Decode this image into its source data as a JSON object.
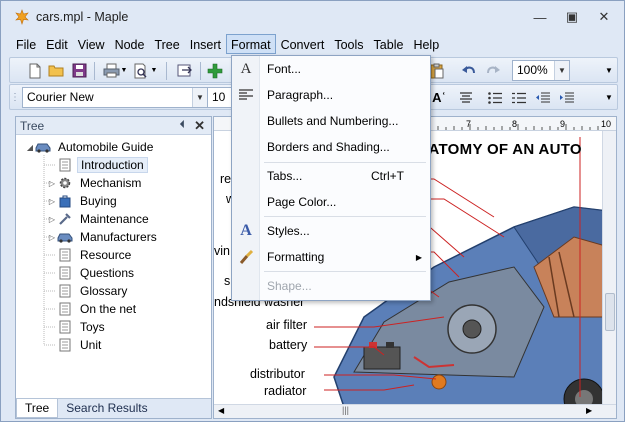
{
  "window": {
    "title": "cars.mpl - Maple",
    "controls": [
      "minimize-icon",
      "restore-icon",
      "close-icon"
    ]
  },
  "menubar": {
    "items": [
      "File",
      "Edit",
      "View",
      "Node",
      "Tree",
      "Insert",
      "Format",
      "Convert",
      "Tools",
      "Table",
      "Help"
    ],
    "active": "Format"
  },
  "toolbar": {
    "zoom": "100%",
    "font_name": "Courier New",
    "font_size": "10"
  },
  "tree_pane": {
    "title": "Tree",
    "root": "Automobile Guide",
    "nodes": [
      "Introduction",
      "Mechanism",
      "Buying",
      "Maintenance",
      "Manufacturers",
      "Resource",
      "Questions",
      "Glossary",
      "On the net",
      "Toys",
      "Unit"
    ],
    "selected": "Introduction",
    "tabs": [
      "Tree",
      "Search Results"
    ]
  },
  "format_menu": {
    "items": [
      {
        "label": "Font...",
        "icon": "font-icon"
      },
      {
        "label": "Paragraph...",
        "icon": "paragraph-icon"
      },
      {
        "label": "Bullets and Numbering...",
        "icon": ""
      },
      {
        "label": "Borders and Shading...",
        "icon": ""
      },
      {
        "label": "Tabs...",
        "shortcut": "Ctrl+T",
        "icon": ""
      },
      {
        "label": "Page Color...",
        "icon": ""
      },
      {
        "label": "Styles...",
        "icon": "styles-icon"
      },
      {
        "label": "Formatting",
        "submenu": true,
        "icon": "formatting-brush-icon"
      },
      {
        "label": "Shape...",
        "disabled": true,
        "icon": ""
      }
    ]
  },
  "document": {
    "title": "IATOMY OF AN AUTO",
    "labels": [
      "re",
      "w",
      "vin",
      "s",
      "ndshield washer",
      "air filter",
      "battery",
      "distributor",
      "radiator"
    ]
  },
  "colors": {
    "accent": "#7da2ce",
    "menu_bg": "#fbfcfe",
    "car_blue": "#5b7fb8",
    "callout_red": "#cc2222"
  }
}
